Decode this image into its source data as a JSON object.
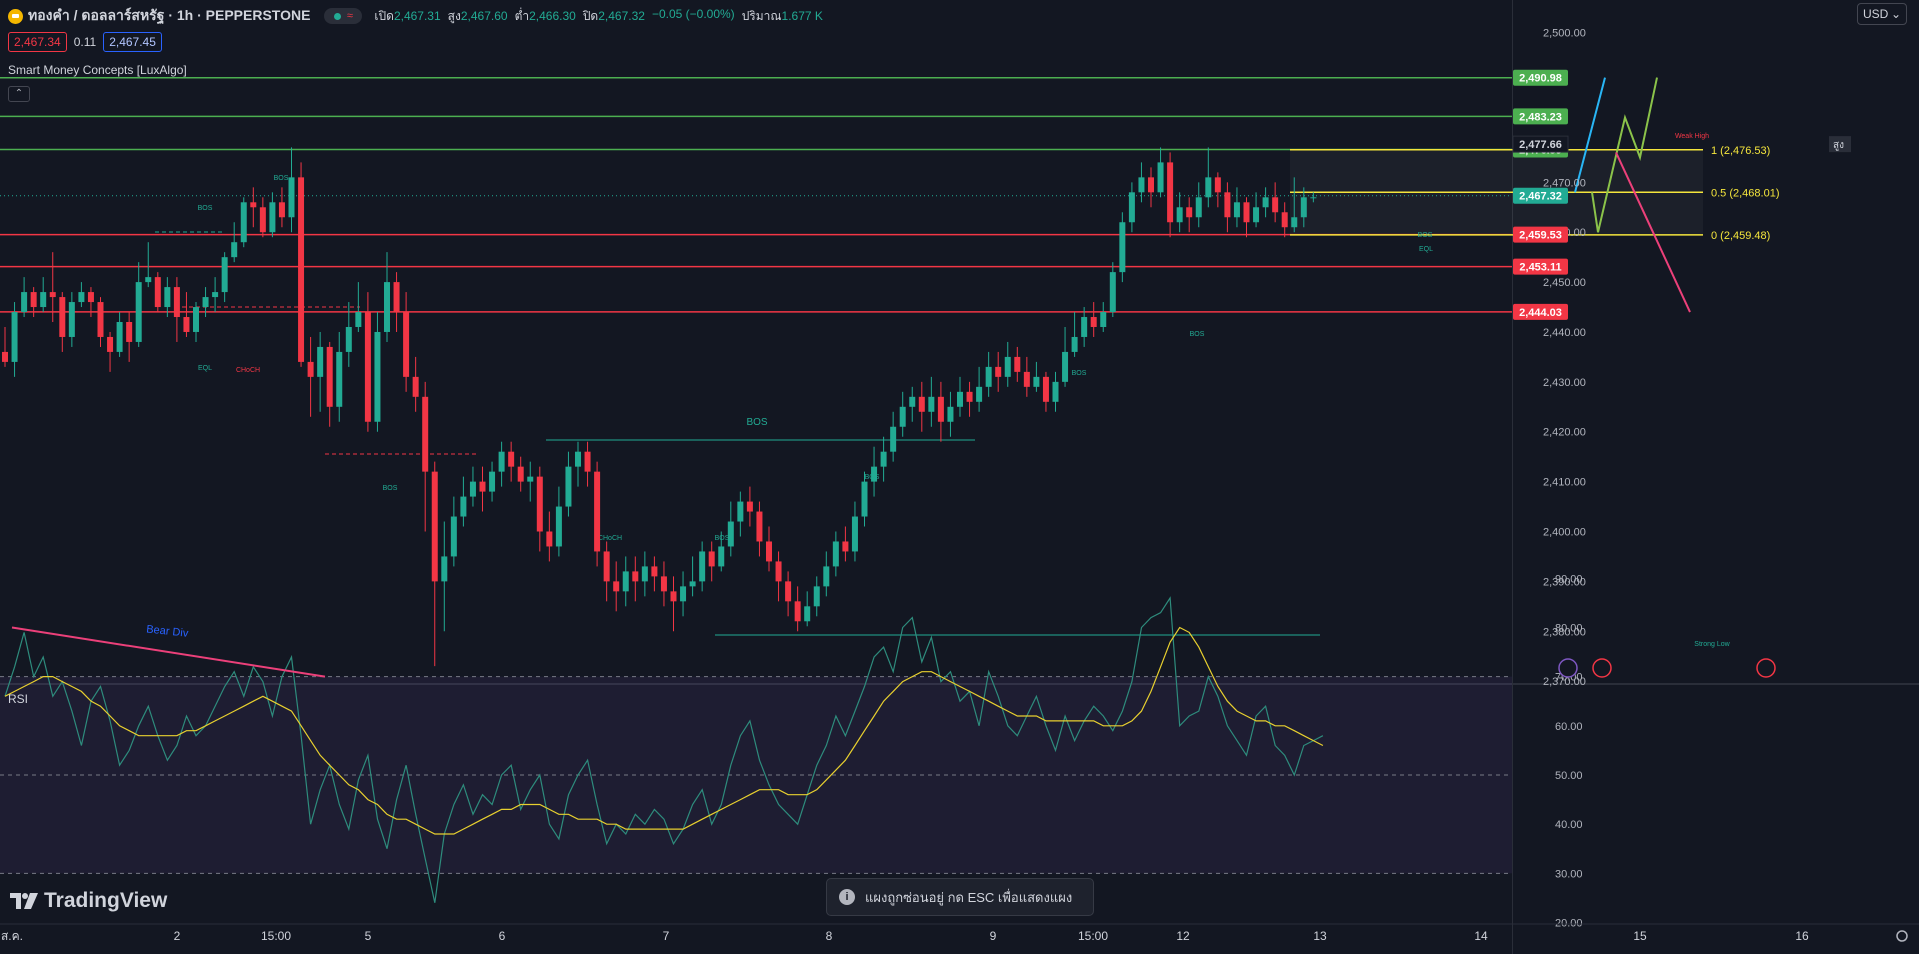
{
  "header": {
    "symbol": "ทองคำ / ดอลลาร์สหรัฐ · 1h · PEPPERSTONE",
    "ohlc": [
      {
        "label": "เปิด",
        "value": "2,467.31"
      },
      {
        "label": "สูง",
        "value": "2,467.60"
      },
      {
        "label": "ต่ำ",
        "value": "2,466.30"
      },
      {
        "label": "ปิด",
        "value": "2,467.32"
      },
      {
        "label": "",
        "value": "−0.05 (−0.00%)"
      },
      {
        "label": "ปริมาณ",
        "value": "1.677 K"
      }
    ],
    "sell_price": "2,467.34",
    "spread": "0.11",
    "buy_price": "2,467.45",
    "currency": "USD"
  },
  "indicator_name": "Smart Money Concepts [LuxAlgo]",
  "rsi_label": "RSI",
  "brand": "TradingView",
  "toast": "แผงถูกซ่อนอยู่ กด ESC เพื่อแสดงแผง",
  "colors": {
    "up": "#22ab94",
    "down": "#f23645",
    "bg": "#131722",
    "rsi": "#2e8c7d",
    "rsi_ma": "#e8d02f",
    "green_line": "#4caf50",
    "red_line": "#f23645",
    "fib": "#f5e63c"
  },
  "chart_data": [
    {
      "type": "candlestick",
      "title": "ทองคำ / ดอลลาร์สหรัฐ · 1h · PEPPERSTONE",
      "ylim": [
        2370,
        2505
      ],
      "y_ticks": [
        "2,370.00",
        "2,380.00",
        "2,390.00",
        "2,400.00",
        "2,410.00",
        "2,420.00",
        "2,430.00",
        "2,440.00",
        "2,450.00",
        "2,460.00",
        "2,470.00",
        "2,500.00"
      ],
      "x_ticks": [
        "ส.ค.",
        "2",
        "15:00",
        "5",
        "6",
        "7",
        "8",
        "9",
        "15:00",
        "12",
        "13",
        "14",
        "15",
        "16"
      ],
      "horizontal_levels": [
        {
          "price": 2490.98,
          "label": "2,490.98",
          "kind": "green"
        },
        {
          "price": 2483.23,
          "label": "2,483.23",
          "kind": "green"
        },
        {
          "price": 2476.59,
          "label": "2,476.59",
          "kind": "green"
        },
        {
          "price": 2459.53,
          "label": "2,459.53",
          "kind": "red"
        },
        {
          "price": 2453.11,
          "label": "2,453.11",
          "kind": "red"
        },
        {
          "price": 2444.03,
          "label": "2,444.03",
          "kind": "red"
        }
      ],
      "current_price": {
        "price": 2467.32,
        "label": "2,467.32"
      },
      "high_marker": {
        "price": 2477.66,
        "label": "2,477.66",
        "tag": "สูง"
      },
      "fib_levels": [
        {
          "price": 2476.53,
          "label": "1 (2,476.53)"
        },
        {
          "price": 2468.01,
          "label": "0.5 (2,468.01)"
        },
        {
          "price": 2459.48,
          "label": "0 (2,459.48)"
        }
      ],
      "structure_labels": [
        "BOS",
        "BOS",
        "EQL",
        "CHoCH",
        "BOS",
        "BOS",
        "BOS",
        "CHoCH",
        "BOS",
        "BOS",
        "BOS",
        "BOS",
        "EQL",
        "Weak High",
        "Strong Low"
      ],
      "candles": [
        [
          2436,
          2434,
          2441,
          2433
        ],
        [
          2434,
          2444,
          2446,
          2431
        ],
        [
          2444,
          2448,
          2451,
          2443
        ],
        [
          2448,
          2445,
          2449,
          2443
        ],
        [
          2445,
          2448,
          2451,
          2444
        ],
        [
          2448,
          2447,
          2456,
          2442
        ],
        [
          2447,
          2439,
          2448,
          2436
        ],
        [
          2439,
          2446,
          2448,
          2437
        ],
        [
          2446,
          2448,
          2450,
          2445
        ],
        [
          2448,
          2446,
          2449,
          2443
        ],
        [
          2446,
          2439,
          2447,
          2437
        ],
        [
          2439,
          2436,
          2440,
          2432
        ],
        [
          2436,
          2442,
          2444,
          2435
        ],
        [
          2442,
          2438,
          2444,
          2434
        ],
        [
          2438,
          2450,
          2454,
          2437
        ],
        [
          2450,
          2451,
          2458,
          2449
        ],
        [
          2451,
          2445,
          2452,
          2444
        ],
        [
          2445,
          2449,
          2451,
          2443
        ],
        [
          2449,
          2443,
          2451,
          2438
        ],
        [
          2443,
          2440,
          2448,
          2439
        ],
        [
          2440,
          2445,
          2446,
          2438
        ],
        [
          2445,
          2447,
          2449,
          2443
        ],
        [
          2447,
          2448,
          2451,
          2444
        ],
        [
          2448,
          2455,
          2456,
          2446
        ],
        [
          2455,
          2458,
          2462,
          2454
        ],
        [
          2458,
          2466,
          2467,
          2457
        ],
        [
          2466,
          2465,
          2469,
          2461
        ],
        [
          2465,
          2460,
          2467,
          2459
        ],
        [
          2460,
          2466,
          2468,
          2459
        ],
        [
          2466,
          2463,
          2469,
          2461
        ],
        [
          2463,
          2471,
          2477,
          2460
        ],
        [
          2471,
          2434,
          2474,
          2433
        ],
        [
          2434,
          2431,
          2439,
          2423
        ],
        [
          2431,
          2437,
          2440,
          2424
        ],
        [
          2437,
          2425,
          2438,
          2421
        ],
        [
          2425,
          2436,
          2440,
          2422
        ],
        [
          2436,
          2441,
          2446,
          2433
        ],
        [
          2441,
          2444,
          2450,
          2440
        ],
        [
          2444,
          2422,
          2448,
          2420
        ],
        [
          2422,
          2440,
          2444,
          2420
        ],
        [
          2440,
          2450,
          2456,
          2438
        ],
        [
          2450,
          2444,
          2452,
          2440
        ],
        [
          2444,
          2431,
          2448,
          2428
        ],
        [
          2431,
          2427,
          2435,
          2424
        ],
        [
          2427,
          2412,
          2430,
          2400
        ],
        [
          2412,
          2390,
          2414,
          2373
        ],
        [
          2390,
          2395,
          2402,
          2380
        ],
        [
          2395,
          2403,
          2407,
          2393
        ],
        [
          2403,
          2407,
          2411,
          2401
        ],
        [
          2407,
          2410,
          2413,
          2405
        ],
        [
          2410,
          2408,
          2413,
          2404
        ],
        [
          2408,
          2412,
          2414,
          2406
        ],
        [
          2412,
          2416,
          2418,
          2409
        ],
        [
          2416,
          2413,
          2418,
          2410
        ],
        [
          2413,
          2410,
          2415,
          2408
        ],
        [
          2410,
          2411,
          2414,
          2406
        ],
        [
          2411,
          2400,
          2413,
          2396
        ],
        [
          2400,
          2397,
          2404,
          2394
        ],
        [
          2397,
          2405,
          2409,
          2395
        ],
        [
          2405,
          2413,
          2416,
          2403
        ],
        [
          2413,
          2416,
          2418,
          2409
        ],
        [
          2416,
          2412,
          2418,
          2409
        ],
        [
          2412,
          2396,
          2414,
          2393
        ],
        [
          2396,
          2390,
          2398,
          2386
        ],
        [
          2390,
          2388,
          2394,
          2384
        ],
        [
          2388,
          2392,
          2395,
          2385
        ],
        [
          2392,
          2390,
          2395,
          2386
        ],
        [
          2390,
          2393,
          2396,
          2387
        ],
        [
          2393,
          2391,
          2395,
          2388
        ],
        [
          2391,
          2388,
          2394,
          2385
        ],
        [
          2388,
          2386,
          2391,
          2380
        ],
        [
          2386,
          2389,
          2392,
          2383
        ],
        [
          2389,
          2390,
          2395,
          2387
        ],
        [
          2390,
          2396,
          2398,
          2388
        ],
        [
          2396,
          2393,
          2398,
          2390
        ],
        [
          2393,
          2397,
          2400,
          2392
        ],
        [
          2397,
          2402,
          2406,
          2395
        ],
        [
          2402,
          2406,
          2408,
          2399
        ],
        [
          2406,
          2404,
          2409,
          2401
        ],
        [
          2404,
          2398,
          2406,
          2395
        ],
        [
          2398,
          2394,
          2401,
          2392
        ],
        [
          2394,
          2390,
          2396,
          2386
        ],
        [
          2390,
          2386,
          2392,
          2383
        ],
        [
          2386,
          2382,
          2389,
          2380
        ],
        [
          2382,
          2385,
          2388,
          2381
        ],
        [
          2385,
          2389,
          2391,
          2383
        ],
        [
          2389,
          2393,
          2396,
          2387
        ],
        [
          2393,
          2398,
          2400,
          2391
        ],
        [
          2398,
          2396,
          2401,
          2394
        ],
        [
          2396,
          2403,
          2406,
          2394
        ],
        [
          2403,
          2410,
          2412,
          2401
        ],
        [
          2410,
          2413,
          2417,
          2407
        ],
        [
          2413,
          2416,
          2419,
          2410
        ],
        [
          2416,
          2421,
          2424,
          2414
        ],
        [
          2421,
          2425,
          2428,
          2419
        ],
        [
          2425,
          2427,
          2429,
          2422
        ],
        [
          2427,
          2424,
          2430,
          2420
        ],
        [
          2424,
          2427,
          2431,
          2421
        ],
        [
          2427,
          2422,
          2430,
          2418
        ],
        [
          2422,
          2425,
          2428,
          2419
        ],
        [
          2425,
          2428,
          2431,
          2423
        ],
        [
          2428,
          2426,
          2430,
          2423
        ],
        [
          2426,
          2429,
          2433,
          2424
        ],
        [
          2429,
          2433,
          2436,
          2427
        ],
        [
          2433,
          2431,
          2436,
          2428
        ],
        [
          2431,
          2435,
          2438,
          2429
        ],
        [
          2435,
          2432,
          2437,
          2430
        ],
        [
          2432,
          2429,
          2435,
          2427
        ],
        [
          2429,
          2431,
          2434,
          2428
        ],
        [
          2431,
          2426,
          2432,
          2424
        ],
        [
          2426,
          2430,
          2432,
          2424
        ],
        [
          2430,
          2436,
          2441,
          2429
        ],
        [
          2436,
          2439,
          2444,
          2435
        ],
        [
          2439,
          2443,
          2445,
          2437
        ],
        [
          2443,
          2441,
          2446,
          2439
        ],
        [
          2441,
          2444,
          2446,
          2440
        ],
        [
          2444,
          2452,
          2454,
          2443
        ],
        [
          2452,
          2462,
          2464,
          2450
        ],
        [
          2462,
          2468,
          2470,
          2460
        ],
        [
          2468,
          2471,
          2474,
          2466
        ],
        [
          2471,
          2468,
          2473,
          2465
        ],
        [
          2468,
          2474,
          2477,
          2467
        ],
        [
          2474,
          2462,
          2476,
          2459
        ],
        [
          2462,
          2465,
          2468,
          2460
        ],
        [
          2465,
          2463,
          2467,
          2460
        ],
        [
          2463,
          2467,
          2470,
          2461
        ],
        [
          2467,
          2471,
          2477,
          2465
        ],
        [
          2471,
          2468,
          2472,
          2465
        ],
        [
          2468,
          2463,
          2470,
          2460
        ],
        [
          2463,
          2466,
          2469,
          2461
        ],
        [
          2466,
          2462,
          2467,
          2459
        ],
        [
          2462,
          2465,
          2468,
          2461
        ],
        [
          2465,
          2467,
          2469,
          2463
        ],
        [
          2467,
          2464,
          2470,
          2462
        ],
        [
          2464,
          2461,
          2466,
          2459
        ],
        [
          2461,
          2463,
          2471,
          2460
        ],
        [
          2463,
          2467,
          2469,
          2461
        ],
        [
          2467,
          2467,
          2468,
          2466
        ]
      ]
    },
    {
      "type": "line",
      "title": "RSI",
      "ylim": [
        20,
        90
      ],
      "y_ticks": [
        "20.00",
        "30.00",
        "40.00",
        "50.00",
        "60.00",
        "70.00",
        "80.00",
        "90.00"
      ],
      "bands": [
        30,
        50,
        70
      ],
      "annotation": "Bear Div",
      "series": [
        {
          "name": "",
          "values": [
            66,
            72,
            79,
            70,
            74,
            66,
            69,
            63,
            56,
            65,
            68,
            61,
            52,
            55,
            60,
            64,
            58,
            53,
            56,
            62,
            58,
            60,
            64,
            68,
            71,
            66,
            72,
            69,
            62,
            70,
            74,
            58,
            40,
            47,
            52,
            44,
            39,
            49,
            54,
            41,
            35,
            45,
            52,
            42,
            33,
            24,
            38,
            44,
            48,
            42,
            46,
            44,
            50,
            52,
            43,
            47,
            50,
            40,
            37,
            46,
            50,
            53,
            44,
            36,
            40,
            38,
            42,
            40,
            43,
            41,
            36,
            39,
            44,
            47,
            40,
            44,
            52,
            58,
            61,
            53,
            48,
            44,
            42,
            40,
            46,
            52,
            56,
            62,
            58,
            63,
            68,
            74,
            76,
            71,
            80,
            82,
            73,
            78,
            69,
            71,
            65,
            67,
            60,
            71,
            66,
            60,
            58,
            62,
            66,
            60,
            55,
            62,
            57,
            61,
            64,
            62,
            59,
            63,
            69,
            80,
            82,
            83,
            86,
            60,
            62,
            63,
            70,
            66,
            60,
            57,
            54,
            62,
            64,
            56,
            54,
            50,
            56,
            57,
            58
          ]
        },
        {
          "name": "",
          "values": [
            66,
            67,
            68,
            69,
            70,
            70,
            69,
            68,
            67,
            65,
            64,
            62,
            60,
            59,
            58,
            58,
            58,
            58,
            58,
            59,
            59,
            60,
            61,
            62,
            63,
            64,
            65,
            66,
            65,
            64,
            63,
            60,
            57,
            54,
            52,
            50,
            48,
            47,
            45,
            44,
            42,
            41,
            41,
            40,
            39,
            38,
            38,
            38,
            39,
            40,
            41,
            42,
            43,
            43,
            44,
            44,
            44,
            43,
            42,
            42,
            41,
            41,
            41,
            40,
            40,
            39,
            39,
            39,
            39,
            39,
            39,
            39,
            40,
            41,
            42,
            43,
            44,
            45,
            46,
            47,
            47,
            47,
            46,
            46,
            46,
            47,
            49,
            51,
            53,
            56,
            59,
            62,
            65,
            67,
            69,
            70,
            71,
            71,
            70,
            69,
            68,
            67,
            66,
            65,
            64,
            63,
            62,
            62,
            62,
            61,
            61,
            61,
            61,
            61,
            61,
            60,
            60,
            60,
            61,
            63,
            67,
            72,
            77,
            80,
            79,
            76,
            72,
            68,
            65,
            63,
            62,
            61,
            61,
            60,
            60,
            59,
            58,
            57,
            56
          ]
        }
      ]
    }
  ]
}
